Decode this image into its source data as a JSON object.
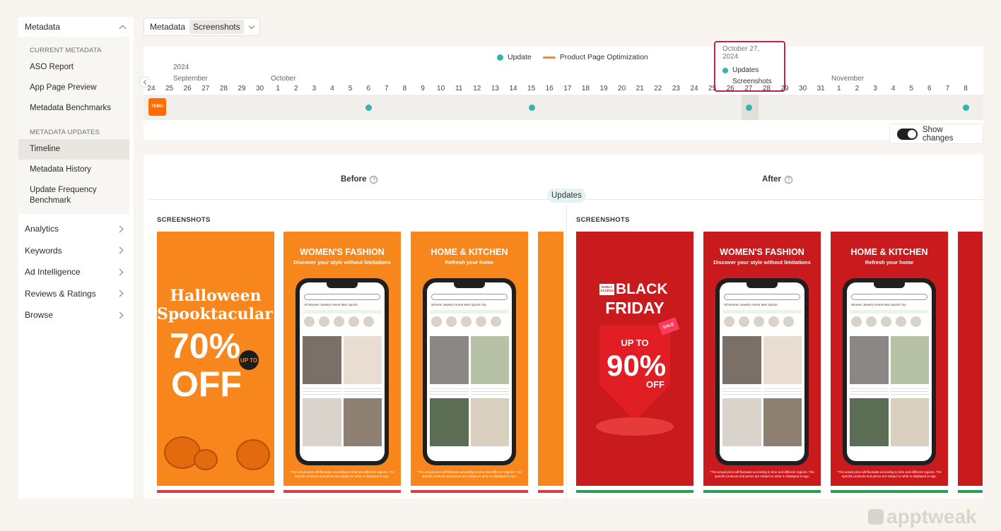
{
  "sidebar": {
    "metadata_label": "Metadata",
    "current_group": "CURRENT METADATA",
    "current_items": [
      {
        "label": "ASO Report"
      },
      {
        "label": "App Page Preview"
      },
      {
        "label": "Metadata Benchmarks"
      }
    ],
    "updates_group": "METADATA UPDATES",
    "updates_items": [
      {
        "label": "Timeline",
        "active": true
      },
      {
        "label": "Metadata History"
      },
      {
        "label": "Update Frequency Benchmark"
      }
    ],
    "sections": [
      {
        "label": "Analytics"
      },
      {
        "label": "Keywords"
      },
      {
        "label": "Ad Intelligence"
      },
      {
        "label": "Reviews & Ratings"
      },
      {
        "label": "Browse"
      }
    ]
  },
  "filter": {
    "label": "Metadata",
    "selected": "Screenshots"
  },
  "timeline": {
    "legend_update": "Update",
    "legend_ppo": "Product Page Optimization",
    "year": "2024",
    "months": [
      "September",
      "October",
      "November"
    ],
    "days": [
      "24",
      "25",
      "26",
      "27",
      "28",
      "29",
      "30",
      "1",
      "2",
      "3",
      "4",
      "5",
      "6",
      "7",
      "8",
      "9",
      "10",
      "11",
      "12",
      "13",
      "14",
      "15",
      "16",
      "17",
      "18",
      "19",
      "20",
      "21",
      "22",
      "23",
      "24",
      "25",
      "26",
      "27",
      "28",
      "29",
      "30",
      "31",
      "1",
      "2",
      "3",
      "4",
      "5",
      "6",
      "7",
      "8"
    ],
    "update_days": [
      "6",
      "15",
      "27",
      "8"
    ],
    "app_icon": "TEMU",
    "tooltip": {
      "date": "October 27, 2024",
      "type": "Updates",
      "field": "Screenshots"
    },
    "colors": {
      "update": "#38b2ad",
      "ppo": "#d99256",
      "highlight": "#c0244d"
    }
  },
  "toggle": {
    "label": "Show changes",
    "on": true
  },
  "compare": {
    "before_label": "Before",
    "after_label": "After",
    "badge": "Updates",
    "before_section": "SCREENSHOTS",
    "after_section": "SCREENSHOTS",
    "before_shots": [
      {
        "theme": "orange",
        "title": "Halloween Spooktacular!",
        "pct": "70%",
        "upto": "UP TO",
        "off": "OFF"
      },
      {
        "theme": "orange",
        "title": "WOMEN'S FASHION",
        "sub": "Discover your style without limitations",
        "foot": "*The actual price will fluctuate according to time and different regions. The specific products and prices are subject to what is displayed in app."
      },
      {
        "theme": "orange",
        "title": "HOME & KITCHEN",
        "sub": "Refresh your home",
        "foot": "*The actual price will fluctuate according to time and different regions. The specific products and prices are subject to what is displayed in app."
      }
    ],
    "after_shots": [
      {
        "theme": "red",
        "early": "EARLY ACCESS",
        "black": "BLACK",
        "friday": "FRIDAY",
        "upto": "UP TO",
        "pct": "90%",
        "off": "OFF",
        "sale": "SALE"
      },
      {
        "theme": "red",
        "title": "WOMEN'S FASHION",
        "sub": "Discover your style without limitations",
        "foot": "*The actual price will fluctuate according to time and different regions. The specific products and prices are subject to what is displayed in app."
      },
      {
        "theme": "red",
        "title": "HOME & KITCHEN",
        "sub": "Refresh your home",
        "foot": "*The actual price will fluctuate according to time and different regions. The specific products and prices are subject to what is displayed in app."
      }
    ],
    "phone_tabs_fashion": "All   Women   Jewelry   Home   Men   Sports",
    "phone_tabs_home": "Women   Jewelry   Home   Men   Sports   Toy"
  },
  "watermark": "apptweak"
}
